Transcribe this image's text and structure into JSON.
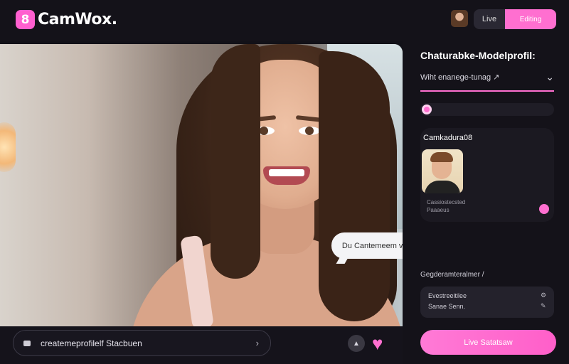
{
  "app": {
    "logo_mark": "8",
    "name": "CamWox."
  },
  "header": {
    "segment_live": "Live",
    "segment_active": "Editing"
  },
  "panel": {
    "title": "Chaturabke-Modelprofil:",
    "dropdown": "Wiht enanege-tunag ↗",
    "card": {
      "title": "Camkadura08",
      "line1": "Cassiostecsted",
      "line2": "Paaaeus"
    },
    "section_label": "Gegderamteralmer /",
    "info": {
      "line1": "Evestreeitilee",
      "line2": "Sanae Senn."
    },
    "cta": "Live Satatsaw"
  },
  "stream": {
    "chat_bubble": "Du Cantemeem varten ah Varstaben",
    "message_input": "createmeprofilelf Stacbuen"
  },
  "colors": {
    "accent": "#ff6fd0",
    "background": "#121118",
    "panel": "#141219"
  },
  "icons": [
    "camera-icon",
    "chevron-right-icon",
    "emoji-icon",
    "heart-icon",
    "chevron-down-icon"
  ]
}
